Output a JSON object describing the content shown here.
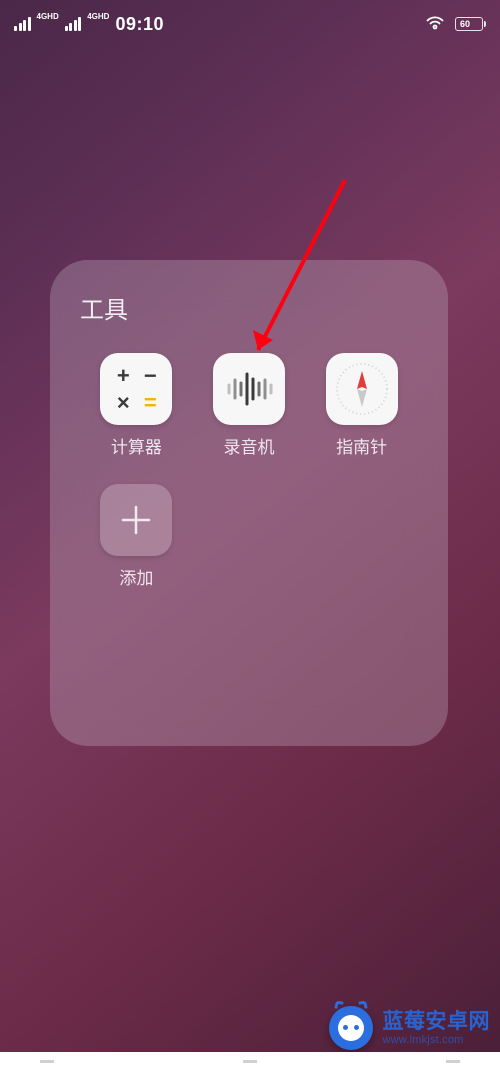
{
  "status": {
    "signal_label_1": "4GHD",
    "signal_label_2": "4GHD",
    "time": "09:10",
    "battery": "60"
  },
  "folder": {
    "title": "工具",
    "apps": [
      {
        "name": "calculator",
        "label": "计算器"
      },
      {
        "name": "recorder",
        "label": "录音机"
      },
      {
        "name": "compass",
        "label": "指南针"
      },
      {
        "name": "add",
        "label": "添加"
      }
    ]
  },
  "watermark": {
    "cn": "蓝莓安卓网",
    "en": "www.lmkjst.com"
  }
}
